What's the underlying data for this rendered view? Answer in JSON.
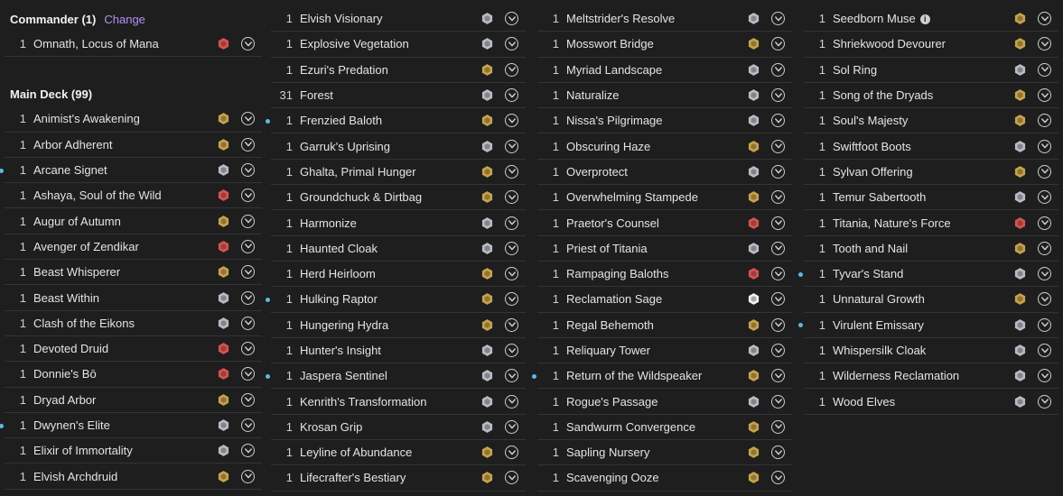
{
  "commander": {
    "label": "Commander (1)",
    "change": "Change",
    "cards": [
      {
        "qty": "1",
        "name": "Omnath, Locus of Mana",
        "icon": "set-symbol-red",
        "color": "#d9534f"
      }
    ]
  },
  "main_deck": {
    "label": "Main Deck (99)",
    "columns": [
      [
        {
          "qty": "1",
          "name": "Animist's Awakening",
          "icon": "set-symbol-gold",
          "color": "#c8a34a"
        },
        {
          "qty": "1",
          "name": "Arbor Adherent",
          "icon": "set-symbol-gold",
          "color": "#c8a34a"
        },
        {
          "qty": "1",
          "name": "Arcane Signet",
          "icon": "set-symbol-silver",
          "color": "#b8bcc4",
          "dot": true
        },
        {
          "qty": "1",
          "name": "Ashaya, Soul of the Wild",
          "icon": "set-symbol-red",
          "color": "#d9534f"
        },
        {
          "qty": "1",
          "name": "Augur of Autumn",
          "icon": "set-symbol-gold",
          "color": "#c8a34a"
        },
        {
          "qty": "1",
          "name": "Avenger of Zendikar",
          "icon": "set-symbol-red",
          "color": "#d9534f"
        },
        {
          "qty": "1",
          "name": "Beast Whisperer",
          "icon": "set-symbol-gold",
          "color": "#c8a34a"
        },
        {
          "qty": "1",
          "name": "Beast Within",
          "icon": "set-symbol-silver",
          "color": "#b8bcc4"
        },
        {
          "qty": "1",
          "name": "Clash of the Eikons",
          "icon": "set-symbol-silver",
          "color": "#b8bcc4"
        },
        {
          "qty": "1",
          "name": "Devoted Druid",
          "icon": "set-symbol-red",
          "color": "#d9534f"
        },
        {
          "qty": "1",
          "name": "Donnie's Bō",
          "icon": "set-symbol-red",
          "color": "#d9534f"
        },
        {
          "qty": "1",
          "name": "Dryad Arbor",
          "icon": "set-symbol-gold",
          "color": "#c8a34a"
        },
        {
          "qty": "1",
          "name": "Dwynen's Elite",
          "icon": "set-symbol-silver",
          "color": "#b8bcc4",
          "dot": true
        },
        {
          "qty": "1",
          "name": "Elixir of Immortality",
          "icon": "set-symbol-silver",
          "color": "#b8bcc4"
        },
        {
          "qty": "1",
          "name": "Elvish Archdruid",
          "icon": "set-symbol-gold",
          "color": "#c8a34a"
        }
      ],
      [
        {
          "qty": "1",
          "name": "Elvish Visionary",
          "icon": "set-symbol-silver",
          "color": "#b8bcc4"
        },
        {
          "qty": "1",
          "name": "Explosive Vegetation",
          "icon": "set-symbol-silver",
          "color": "#b8bcc4"
        },
        {
          "qty": "1",
          "name": "Ezuri's Predation",
          "icon": "set-symbol-gold",
          "color": "#c8a34a"
        },
        {
          "qty": "31",
          "name": "Forest",
          "icon": "set-symbol-silver",
          "color": "#b8bcc4"
        },
        {
          "qty": "1",
          "name": "Frenzied Baloth",
          "icon": "set-symbol-gold",
          "color": "#c8a34a",
          "dot": true
        },
        {
          "qty": "1",
          "name": "Garruk's Uprising",
          "icon": "set-symbol-silver",
          "color": "#b8bcc4"
        },
        {
          "qty": "1",
          "name": "Ghalta, Primal Hunger",
          "icon": "set-symbol-gold",
          "color": "#c8a34a"
        },
        {
          "qty": "1",
          "name": "Groundchuck & Dirtbag",
          "icon": "set-symbol-gold",
          "color": "#c8a34a"
        },
        {
          "qty": "1",
          "name": "Harmonize",
          "icon": "set-symbol-silver",
          "color": "#b8bcc4"
        },
        {
          "qty": "1",
          "name": "Haunted Cloak",
          "icon": "set-symbol-silver",
          "color": "#b8bcc4"
        },
        {
          "qty": "1",
          "name": "Herd Heirloom",
          "icon": "set-symbol-gold",
          "color": "#c8a34a"
        },
        {
          "qty": "1",
          "name": "Hulking Raptor",
          "icon": "set-symbol-gold",
          "color": "#c8a34a",
          "dot": true
        },
        {
          "qty": "1",
          "name": "Hungering Hydra",
          "icon": "set-symbol-gold",
          "color": "#c8a34a"
        },
        {
          "qty": "1",
          "name": "Hunter's Insight",
          "icon": "set-symbol-silver",
          "color": "#b8bcc4"
        },
        {
          "qty": "1",
          "name": "Jaspera Sentinel",
          "icon": "set-symbol-silver",
          "color": "#b8bcc4",
          "dot": true
        },
        {
          "qty": "1",
          "name": "Kenrith's Transformation",
          "icon": "set-symbol-silver",
          "color": "#b8bcc4"
        },
        {
          "qty": "1",
          "name": "Krosan Grip",
          "icon": "set-symbol-silver",
          "color": "#b8bcc4"
        },
        {
          "qty": "1",
          "name": "Leyline of Abundance",
          "icon": "set-symbol-gold",
          "color": "#c8a34a"
        },
        {
          "qty": "1",
          "name": "Lifecrafter's Bestiary",
          "icon": "set-symbol-gold",
          "color": "#c8a34a"
        }
      ],
      [
        {
          "qty": "1",
          "name": "Meltstrider's Resolve",
          "icon": "set-symbol-silver",
          "color": "#b8bcc4"
        },
        {
          "qty": "1",
          "name": "Mosswort Bridge",
          "icon": "set-symbol-gold",
          "color": "#c8a34a"
        },
        {
          "qty": "1",
          "name": "Myriad Landscape",
          "icon": "set-symbol-silver",
          "color": "#b8bcc4"
        },
        {
          "qty": "1",
          "name": "Naturalize",
          "icon": "set-symbol-silver",
          "color": "#b8bcc4"
        },
        {
          "qty": "1",
          "name": "Nissa's Pilgrimage",
          "icon": "set-symbol-silver",
          "color": "#b8bcc4"
        },
        {
          "qty": "1",
          "name": "Obscuring Haze",
          "icon": "set-symbol-gold",
          "color": "#c8a34a"
        },
        {
          "qty": "1",
          "name": "Overprotect",
          "icon": "set-symbol-silver",
          "color": "#b8bcc4"
        },
        {
          "qty": "1",
          "name": "Overwhelming Stampede",
          "icon": "set-symbol-gold",
          "color": "#c8a34a"
        },
        {
          "qty": "1",
          "name": "Praetor's Counsel",
          "icon": "set-symbol-red",
          "color": "#d9534f"
        },
        {
          "qty": "1",
          "name": "Priest of Titania",
          "icon": "set-symbol-silver",
          "color": "#b8bcc4"
        },
        {
          "qty": "1",
          "name": "Rampaging Baloths",
          "icon": "set-symbol-red",
          "color": "#d9534f"
        },
        {
          "qty": "1",
          "name": "Reclamation Sage",
          "icon": "set-symbol-white",
          "color": "#f2f2f2"
        },
        {
          "qty": "1",
          "name": "Regal Behemoth",
          "icon": "set-symbol-gold",
          "color": "#c8a34a"
        },
        {
          "qty": "1",
          "name": "Reliquary Tower",
          "icon": "set-symbol-silver",
          "color": "#b8bcc4"
        },
        {
          "qty": "1",
          "name": "Return of the Wildspeaker",
          "icon": "set-symbol-gold",
          "color": "#c8a34a",
          "dot": true
        },
        {
          "qty": "1",
          "name": "Rogue's Passage",
          "icon": "set-symbol-silver",
          "color": "#b8bcc4"
        },
        {
          "qty": "1",
          "name": "Sandwurm Convergence",
          "icon": "set-symbol-gold",
          "color": "#c8a34a"
        },
        {
          "qty": "1",
          "name": "Sapling Nursery",
          "icon": "set-symbol-gold",
          "color": "#c8a34a"
        },
        {
          "qty": "1",
          "name": "Scavenging Ooze",
          "icon": "set-symbol-gold",
          "color": "#c8a34a"
        }
      ],
      [
        {
          "qty": "1",
          "name": "Seedborn Muse",
          "icon": "set-symbol-gold",
          "color": "#c8a34a",
          "info": true
        },
        {
          "qty": "1",
          "name": "Shriekwood Devourer",
          "icon": "set-symbol-gold",
          "color": "#c8a34a"
        },
        {
          "qty": "1",
          "name": "Sol Ring",
          "icon": "set-symbol-silver",
          "color": "#b8bcc4"
        },
        {
          "qty": "1",
          "name": "Song of the Dryads",
          "icon": "set-symbol-gold",
          "color": "#c8a34a"
        },
        {
          "qty": "1",
          "name": "Soul's Majesty",
          "icon": "set-symbol-gold",
          "color": "#c8a34a"
        },
        {
          "qty": "1",
          "name": "Swiftfoot Boots",
          "icon": "set-symbol-silver",
          "color": "#b8bcc4"
        },
        {
          "qty": "1",
          "name": "Sylvan Offering",
          "icon": "set-symbol-gold",
          "color": "#c8a34a"
        },
        {
          "qty": "1",
          "name": "Temur Sabertooth",
          "icon": "set-symbol-silver",
          "color": "#b8bcc4"
        },
        {
          "qty": "1",
          "name": "Titania, Nature's Force",
          "icon": "set-symbol-red",
          "color": "#d9534f"
        },
        {
          "qty": "1",
          "name": "Tooth and Nail",
          "icon": "set-symbol-gold",
          "color": "#c8a34a"
        },
        {
          "qty": "1",
          "name": "Tyvar's Stand",
          "icon": "set-symbol-silver",
          "color": "#b8bcc4",
          "dot": true
        },
        {
          "qty": "1",
          "name": "Unnatural Growth",
          "icon": "set-symbol-gold",
          "color": "#c8a34a"
        },
        {
          "qty": "1",
          "name": "Virulent Emissary",
          "icon": "set-symbol-silver",
          "color": "#b8bcc4",
          "dot": true
        },
        {
          "qty": "1",
          "name": "Whispersilk Cloak",
          "icon": "set-symbol-silver",
          "color": "#b8bcc4"
        },
        {
          "qty": "1",
          "name": "Wilderness Reclamation",
          "icon": "set-symbol-silver",
          "color": "#b8bcc4"
        },
        {
          "qty": "1",
          "name": "Wood Elves",
          "icon": "set-symbol-silver",
          "color": "#b8bcc4"
        }
      ]
    ]
  },
  "icons": {
    "menu": "chevron-down-circle-icon",
    "info": "info-icon",
    "dot": "new-card-dot"
  },
  "colors": {
    "background": "#1e1e1f",
    "divider": "#343436",
    "change_link": "#b58ff0",
    "dot": "#5fb8e6"
  }
}
